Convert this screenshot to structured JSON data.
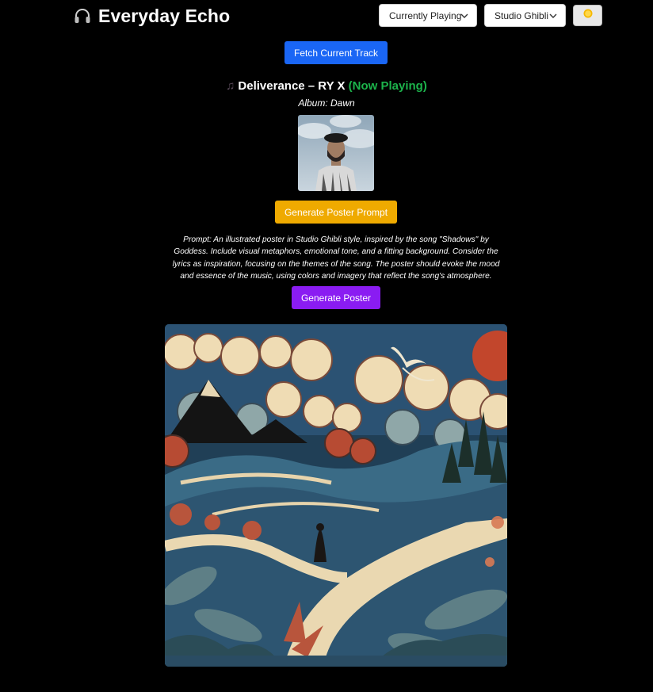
{
  "header": {
    "title": "Everyday Echo",
    "icon": "headphones-icon",
    "source_select": {
      "value": "Currently Playing"
    },
    "style_select": {
      "value": "Studio Ghibli"
    },
    "theme_toggle": {
      "icon": "sun-icon"
    }
  },
  "actions": {
    "fetch_label": "Fetch Current Track",
    "generate_prompt_label": "Generate Poster Prompt",
    "generate_poster_label": "Generate Poster"
  },
  "track": {
    "note_icon": "music-note-icon",
    "title_artist": "Deliverance – RY X",
    "status": "(Now Playing)",
    "album": "Album: Dawn"
  },
  "prompt": {
    "text": "Prompt: An illustrated poster in Studio Ghibli style, inspired by the song \"Shadows\" by Goddess. Include visual metaphors, emotional tone, and a fitting background. Consider the lyrics as inspiration, focusing on the themes of the song. The poster should evoke the mood and essence of the music, using colors and imagery that reflect the song's atmosphere."
  },
  "colors": {
    "background": "#000000",
    "fetch_button": "#1a66f5",
    "prompt_button": "#efaa00",
    "poster_button": "#8a1cf2",
    "now_playing": "#1cb34b"
  }
}
